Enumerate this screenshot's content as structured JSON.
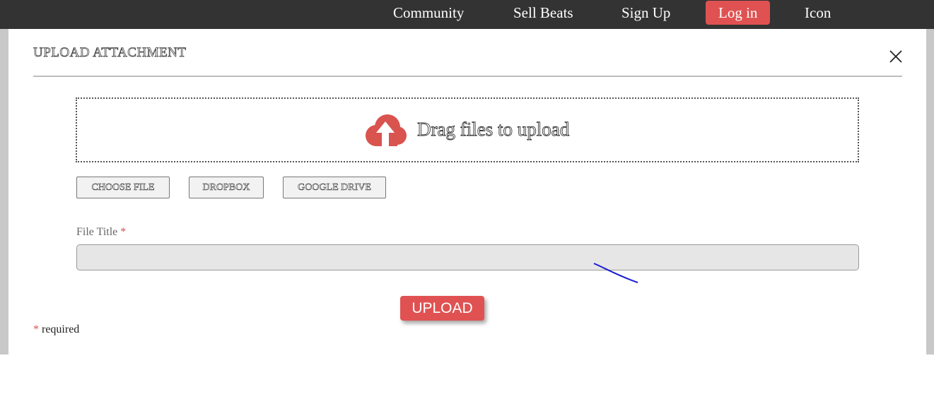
{
  "nav": {
    "items": [
      {
        "label": "Community"
      },
      {
        "label": "Sell Beats"
      },
      {
        "label": "Sign Up"
      },
      {
        "label": "Log in"
      },
      {
        "label": "Icon"
      }
    ],
    "bg_color": "#333333",
    "login_color": "#e05252"
  },
  "modal": {
    "title": "UPLOAD ATTACHMENT",
    "close_icon": "close-x-icon",
    "dropzone": {
      "text": "Drag files to upload",
      "icon": "cloud-upload-icon",
      "icon_color": "#d9534f"
    },
    "sources": {
      "choose_file": "CHOOSE FILE",
      "dropbox": "DROPBOX",
      "google_drive": "GOOGLE DRIVE"
    },
    "file_title": {
      "label": "File Title",
      "required_mark": "*",
      "value": "",
      "placeholder": ""
    },
    "upload_button": "UPLOAD",
    "required_note": {
      "mark": "*",
      "text": " required"
    }
  }
}
